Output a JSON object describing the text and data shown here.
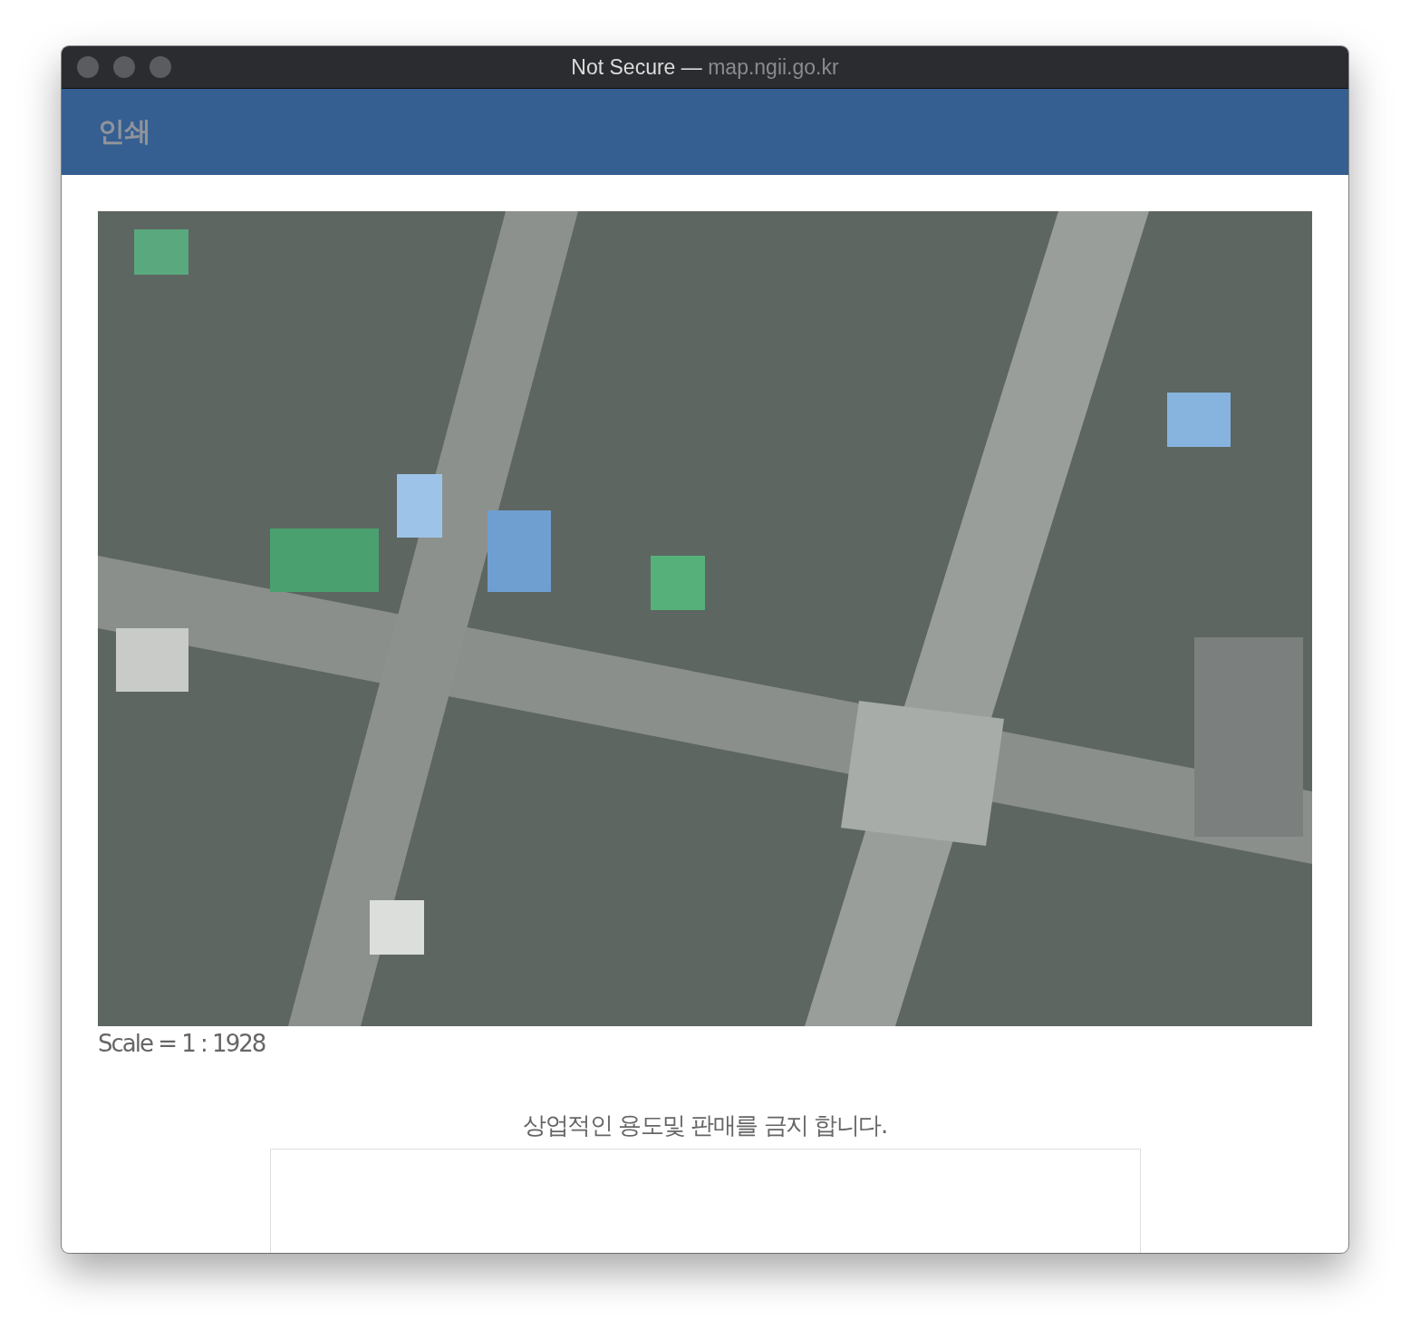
{
  "window": {
    "title": "Not Secure —",
    "address": "map.ngii.go.kr"
  },
  "header": {
    "title": "인쇄"
  },
  "print": {
    "scale": "Scale = 1 : 1928",
    "notice": "상업적인 용도및 판매를 금지 합니다."
  }
}
